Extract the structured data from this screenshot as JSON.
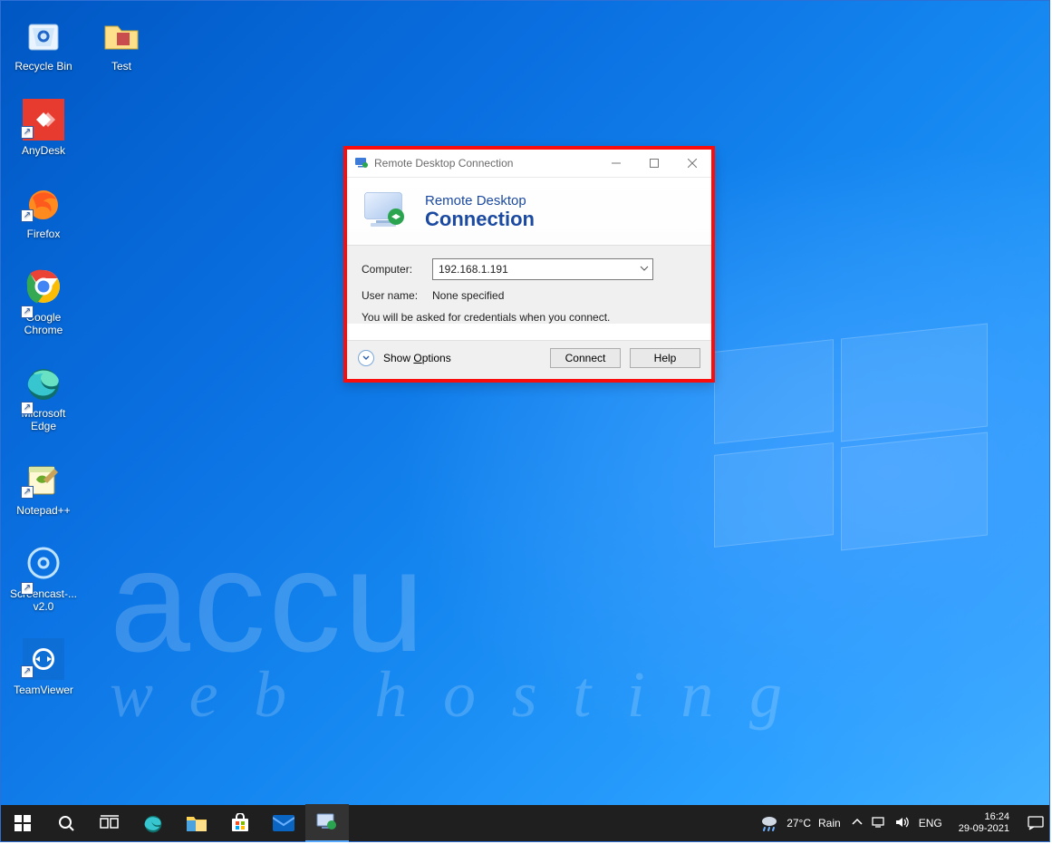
{
  "desktop": {
    "icons": [
      {
        "label": "Recycle Bin",
        "shortcut": false
      },
      {
        "label": "Test",
        "shortcut": false
      },
      {
        "label": "AnyDesk",
        "shortcut": true
      },
      {
        "label": "Firefox",
        "shortcut": true
      },
      {
        "label": "Google Chrome",
        "shortcut": true
      },
      {
        "label": "Microsoft Edge",
        "shortcut": true
      },
      {
        "label": "Notepad++",
        "shortcut": true
      },
      {
        "label": "Screencast-... v2.0",
        "shortcut": true
      },
      {
        "label": "TeamViewer",
        "shortcut": true
      }
    ]
  },
  "watermark": {
    "line1": "accu",
    "line2": "web   hosting"
  },
  "rdc": {
    "title": "Remote Desktop Connection",
    "hero_line1": "Remote Desktop",
    "hero_line2": "Connection",
    "computer_label": "Computer:",
    "computer_value": "192.168.1.191",
    "username_label": "User name:",
    "username_value": "None specified",
    "hint": "You will be asked for credentials when you connect.",
    "show_options": "Show Options",
    "connect": "Connect",
    "help": "Help"
  },
  "taskbar": {
    "weather_temp": "27°C",
    "weather_cond": "Rain",
    "lang": "ENG",
    "time": "16:24",
    "date": "29-09-2021"
  }
}
